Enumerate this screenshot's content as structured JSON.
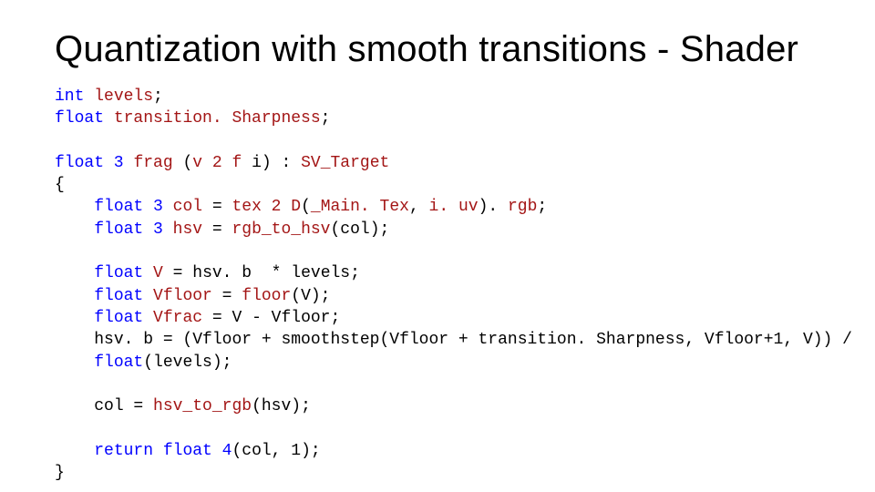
{
  "title": "Quantization with smooth transitions - Shader",
  "code": {
    "kw_int": "int",
    "id_levels": "levels",
    "semi": ";",
    "kw_float": "float",
    "id_transitionSharpness": "transition. Sharpness",
    "kw_float3": "float 3",
    "id_frag": "frag",
    "txt_open_paren": " (",
    "id_v2f": "v 2 f",
    "txt_i_paren": " i) : ",
    "id_svtarget": "SV_Target",
    "brace_open": "{",
    "indent": "    ",
    "id_col": "col",
    "txt_eq": " = ",
    "id_tex2d": "tex 2 D",
    "txt_open": "(",
    "id_maintex": "_Main. Tex",
    "txt_comma_sp": ", ",
    "id_iuv": "i. uv",
    "txt_close_dot": "). ",
    "id_rgb": "rgb",
    "id_hsv": "hsv",
    "id_rgb_to_hsv": "rgb_to_hsv",
    "txt_paren_col": "(col);",
    "id_V": "V",
    "txt_eq_hsv_b": " = hsv. b  * levels;",
    "id_Vfloor": "Vfloor",
    "txt_eq_sp": " = ",
    "id_floor": "floor",
    "txt_paren_V": "(V);",
    "id_Vfrac": "Vfrac",
    "txt_eq_V_minus_Vfloor": " = V - Vfloor;",
    "txt_hsv_b_line": "hsv. b = (Vfloor + smoothstep(Vfloor + transition. Sharpness, Vfloor+1, V)) /",
    "kw_float_cast": "float",
    "txt_levels_paren": "(levels);",
    "txt_col_eq": "col = ",
    "id_hsv_to_rgb": "hsv_to_rgb",
    "txt_paren_hsv": "(hsv);",
    "kw_return": "return",
    "sp": " ",
    "kw_float4": "float 4",
    "txt_col_1": "(col, 1);",
    "brace_close": "}"
  }
}
